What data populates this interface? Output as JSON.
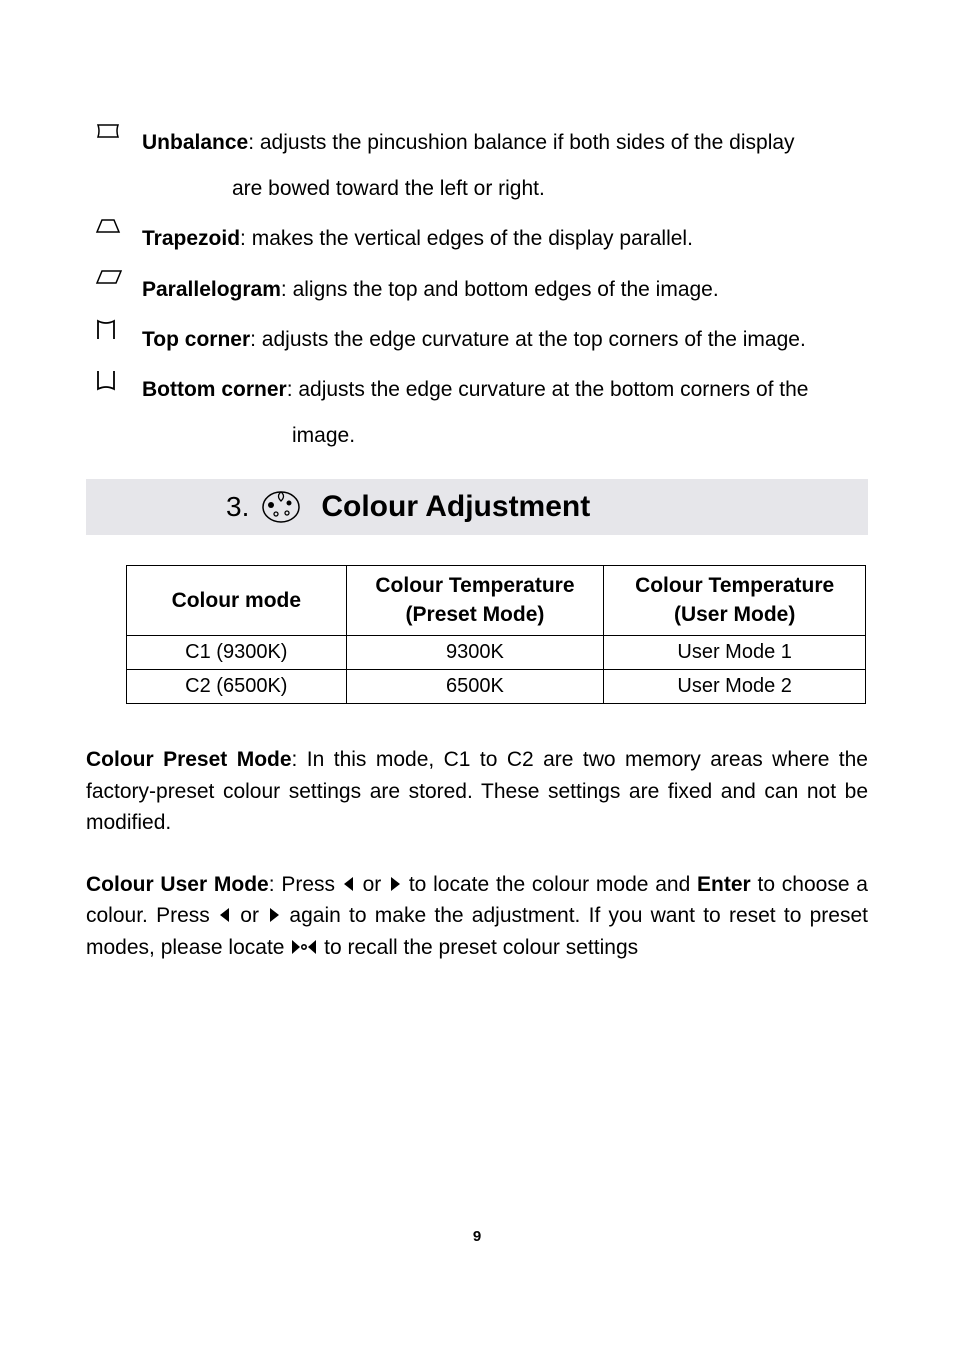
{
  "definitions": [
    {
      "icon": "unbalance-icon",
      "term": "Unbalance",
      "desc": ": adjusts the pincushion balance if both sides of the display",
      "continue": "are bowed toward the left or right."
    },
    {
      "icon": "trapezoid-icon",
      "term": "Trapezoid",
      "desc": ": makes the vertical edges of the display parallel."
    },
    {
      "icon": "parallelogram-icon",
      "term": "Parallelogram",
      "desc": ": aligns the top and bottom edges of the image."
    },
    {
      "icon": "top-corner-icon",
      "term": "Top corner",
      "desc": ": adjusts the edge curvature at the top corners of the image."
    },
    {
      "icon": "bottom-corner-icon",
      "term": "Bottom corner",
      "desc": ": adjusts the edge curvature at the bottom corners of the",
      "continue": "image."
    }
  ],
  "section": {
    "number": "3.",
    "title": "Colour Adjustment"
  },
  "table": {
    "headers": {
      "c0": "Colour mode",
      "c1a": "Colour Temperature",
      "c1b": "(Preset Mode)",
      "c2a": "Colour Temperature",
      "c2b": "(User Mode)"
    },
    "rows": [
      {
        "c0": "C1  (9300K)",
        "c1": "9300K",
        "c2": "User Mode 1"
      },
      {
        "c0": "C2  (6500K)",
        "c1": "6500K",
        "c2": "User Mode 2"
      }
    ]
  },
  "para1": {
    "term": "Colour Preset Mode",
    "text": ": In this mode, C1 to C2 are two memory areas where the factory-preset colour settings are stored.  These settings are fixed and can not be modified."
  },
  "para2": {
    "term": "Colour User Mode",
    "t1": ": Press ",
    "t2": " or ",
    "t3": "  to locate the colour mode and ",
    "enter": "Enter",
    "t4": " to choose a colour.  Press ",
    "t5": " or ",
    "t6": "  again to make the adjustment.  If you want to reset to preset modes, please locate  ",
    "t7": "  to recall the preset colour settings"
  },
  "page_number": "9"
}
